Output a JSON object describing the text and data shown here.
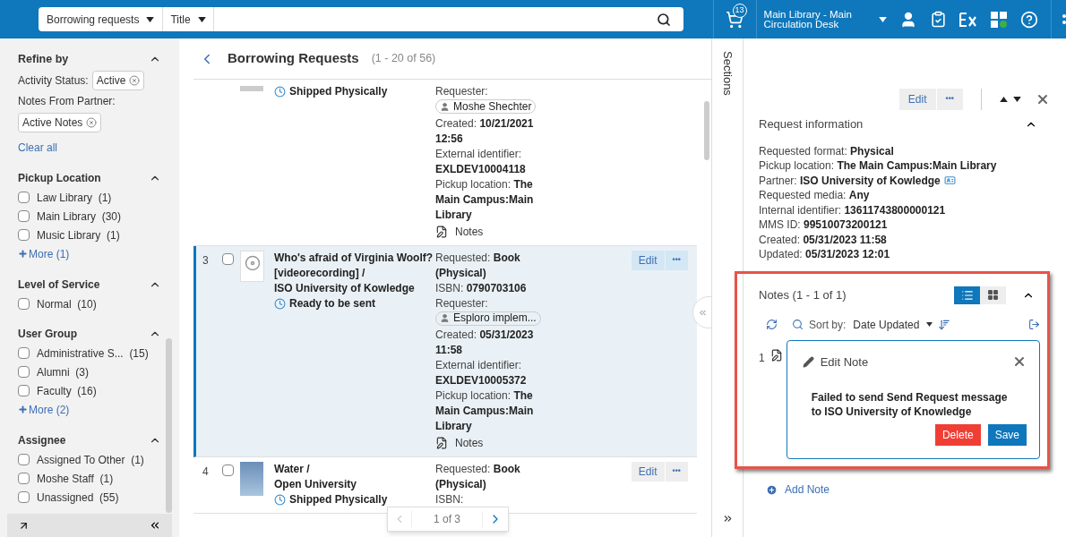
{
  "topbar": {
    "scope": "Borrowing requests",
    "field": "Title",
    "cart_count": "13",
    "location_line1": "Main Library - Main",
    "location_line2": "Circulation Desk"
  },
  "sidebar": {
    "title": "Refine by",
    "filters": [
      {
        "label": "Activity Status:",
        "chip": "Active"
      },
      {
        "label": "Notes From Partner:",
        "chip": "Active Notes"
      }
    ],
    "clear": "Clear all",
    "facets": [
      {
        "title": "Pickup Location",
        "expanded": true,
        "options": [
          {
            "label": "Law Library",
            "count": "(1)",
            "checked": false
          },
          {
            "label": "Main Library",
            "count": "(30)",
            "checked": false
          },
          {
            "label": "Music Library",
            "count": "(1)",
            "checked": false
          }
        ],
        "more": "More (1)"
      },
      {
        "title": "Level of Service",
        "expanded": true,
        "options": [
          {
            "label": "Normal",
            "count": "(10)",
            "checked": false
          }
        ]
      },
      {
        "title": "User Group",
        "expanded": true,
        "options": [
          {
            "label": "Administrative S...",
            "count": "(15)",
            "checked": false
          },
          {
            "label": "Alumni",
            "count": "(3)",
            "checked": false
          },
          {
            "label": "Faculty",
            "count": "(16)",
            "checked": false
          }
        ],
        "more": "More (2)"
      },
      {
        "title": "Assignee",
        "expanded": true,
        "options": [
          {
            "label": "Assigned To Other",
            "count": "(1)",
            "checked": false
          },
          {
            "label": "Moshe Staff",
            "count": "(1)",
            "checked": false
          },
          {
            "label": "Unassigned",
            "count": "(55)",
            "checked": false
          }
        ]
      }
    ]
  },
  "main": {
    "title": "Borrowing Requests",
    "range": "(1 - 20 of 56)",
    "rows": [
      {
        "number": "",
        "selected": false,
        "thumbnail": {
          "kind": "partial"
        },
        "title_lines": [],
        "status": "Shipped Physically",
        "details": [
          {
            "kind": "requester",
            "label": "Requester:",
            "value": "Moshe Shechter"
          },
          {
            "kind": "field",
            "label": "Created:",
            "value": "10/21/2021 12:56"
          },
          {
            "kind": "field",
            "label": "External identifier:",
            "value": "EXLDEV10004118"
          },
          {
            "kind": "field",
            "label": "Pickup location:",
            "value": "The Main Campus:Main Library"
          },
          {
            "kind": "notes",
            "label": "Notes"
          }
        ]
      },
      {
        "number": "3",
        "selected": true,
        "checked": false,
        "thumbnail": {
          "kind": "disc"
        },
        "title_lines": [
          "Who's afraid of Virginia Woolf? [videorecording] /",
          "ISO University of Kowledge"
        ],
        "status": "Ready to be sent",
        "edit": "Edit",
        "more": "•••",
        "details": [
          {
            "kind": "field",
            "label": "Requested:",
            "value": "Book (Physical)"
          },
          {
            "kind": "field",
            "label": "ISBN:",
            "value": "0790703106"
          },
          {
            "kind": "requester",
            "label": "Requester:",
            "value": "Esploro implem..."
          },
          {
            "kind": "field",
            "label": "Created:",
            "value": "05/31/2023 11:58"
          },
          {
            "kind": "field",
            "label": "External identifier:",
            "value": "EXLDEV10005372"
          },
          {
            "kind": "field",
            "label": "Pickup location:",
            "value": "The Main Campus:Main Library"
          },
          {
            "kind": "notes",
            "label": "Notes"
          }
        ]
      },
      {
        "number": "4",
        "selected": false,
        "checked": false,
        "thumbnail": {
          "kind": "cover"
        },
        "title_lines": [
          "Water /",
          "Open University"
        ],
        "status": "Shipped Physically",
        "edit": "Edit",
        "more": "•••",
        "details": [
          {
            "kind": "field",
            "label": "Requested:",
            "value": "Book (Physical)"
          },
          {
            "kind": "label",
            "label": "ISBN:"
          }
        ]
      }
    ],
    "pagination": "1 of 3"
  },
  "sections_label": "Sections",
  "panel": {
    "edit": "Edit",
    "more": "•••",
    "section_title": "Request information",
    "fields": [
      {
        "label": "Requested format:",
        "value": "Physical",
        "card": false
      },
      {
        "label": "Pickup location:",
        "value": "The Main Campus:Main Library",
        "card": false
      },
      {
        "label": "Partner:",
        "value": "ISO University of Kowledge",
        "card": true
      },
      {
        "label": "Requested media:",
        "value": "Any",
        "card": false
      },
      {
        "label": "Internal identifier:",
        "value": "13611743800000121",
        "card": false
      },
      {
        "label": "MMS ID:",
        "value": "99510073200121",
        "card": false
      },
      {
        "label": "Created:",
        "value": "05/31/2023 11:58",
        "card": false
      },
      {
        "label": "Updated:",
        "value": "05/31/2023 12:01",
        "card": false
      }
    ],
    "notes": {
      "title": "Notes (1 - 1 of 1)",
      "views": [
        {
          "kind": "list",
          "selected": true
        },
        {
          "kind": "grid",
          "selected": false
        }
      ],
      "sort_label": "Sort by:",
      "sort_value": "Date Updated",
      "items": [
        {
          "number": "1",
          "editor_title": "Edit Note",
          "text": "Failed to send Send Request message to ISO University of Knowledge",
          "delete": "Delete",
          "save": "Save"
        }
      ],
      "add": "Add Note"
    }
  }
}
